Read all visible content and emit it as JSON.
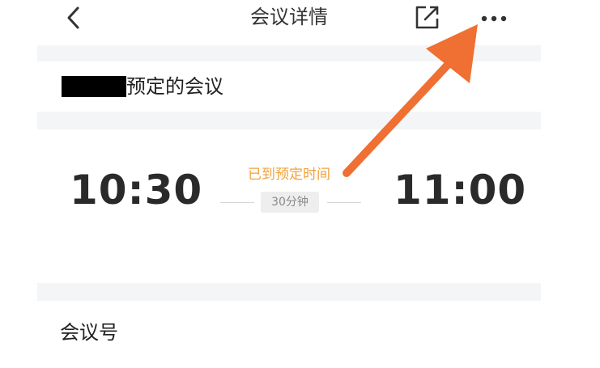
{
  "header": {
    "title": "会议详情"
  },
  "organizer": {
    "suffix": "预定的会议"
  },
  "time": {
    "start": "10:30",
    "end": "11:00",
    "status": "已到预定时间",
    "duration": "30分钟"
  },
  "meeting_info": {
    "number_label": "会议号"
  },
  "colors": {
    "status": "#f0a23c",
    "arrow": "#ef7032",
    "divider": "#f4f5f7"
  }
}
